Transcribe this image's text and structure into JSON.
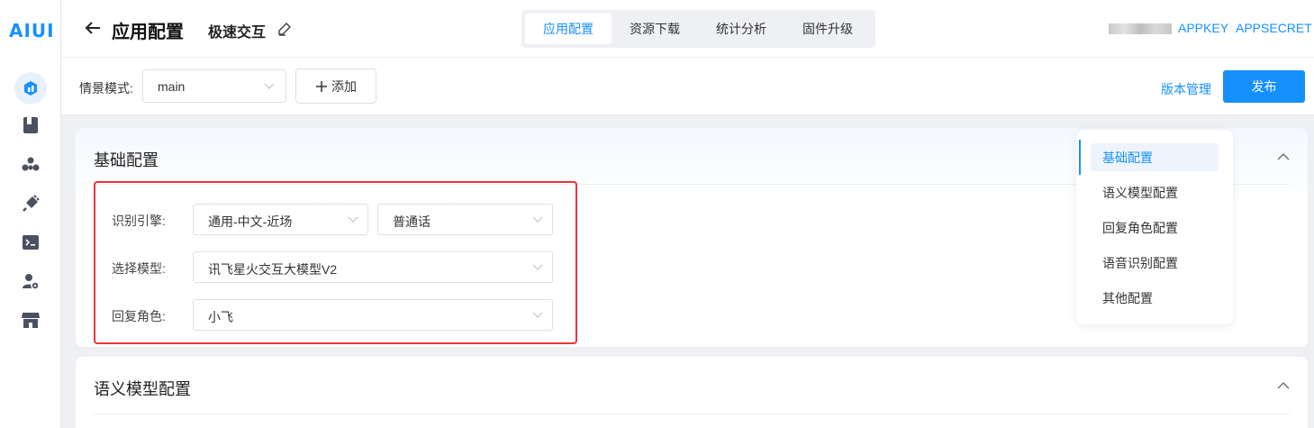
{
  "sidebar": {
    "logo": "AIUI",
    "icons": [
      "home-icon",
      "book-icon",
      "group-icon",
      "plugin-icon",
      "terminal-icon",
      "user-settings-icon",
      "store-icon"
    ]
  },
  "header": {
    "title": "应用配置",
    "app_name": "极速交互",
    "tabs": [
      {
        "label": "应用配置",
        "active": true
      },
      {
        "label": "资源下载",
        "active": false
      },
      {
        "label": "统计分析",
        "active": false
      },
      {
        "label": "固件升级",
        "active": false
      }
    ],
    "links": {
      "appkey": "APPKEY",
      "appsecret": "APPSECRET"
    }
  },
  "toolbar": {
    "scene_label": "情景模式:",
    "scene_value": "main",
    "add_label": "添加",
    "version_label": "版本管理",
    "publish_label": "发布"
  },
  "basic_config": {
    "title": "基础配置",
    "engine_label": "识别引擎:",
    "engine_value": "通用-中文-近场",
    "accent_value": "普通话",
    "model_label": "选择模型:",
    "model_value": "讯飞星火交互大模型V2",
    "role_label": "回复角色:",
    "role_value": "小飞"
  },
  "semantic_config": {
    "title": "语义模型配置"
  },
  "anchor_nav": {
    "items": [
      {
        "label": "基础配置",
        "active": true
      },
      {
        "label": "语义模型配置",
        "active": false
      },
      {
        "label": "回复角色配置",
        "active": false
      },
      {
        "label": "语音识别配置",
        "active": false
      },
      {
        "label": "其他配置",
        "active": false
      }
    ]
  },
  "colors": {
    "accent": "#1790ff",
    "highlight": "#e8353b"
  }
}
